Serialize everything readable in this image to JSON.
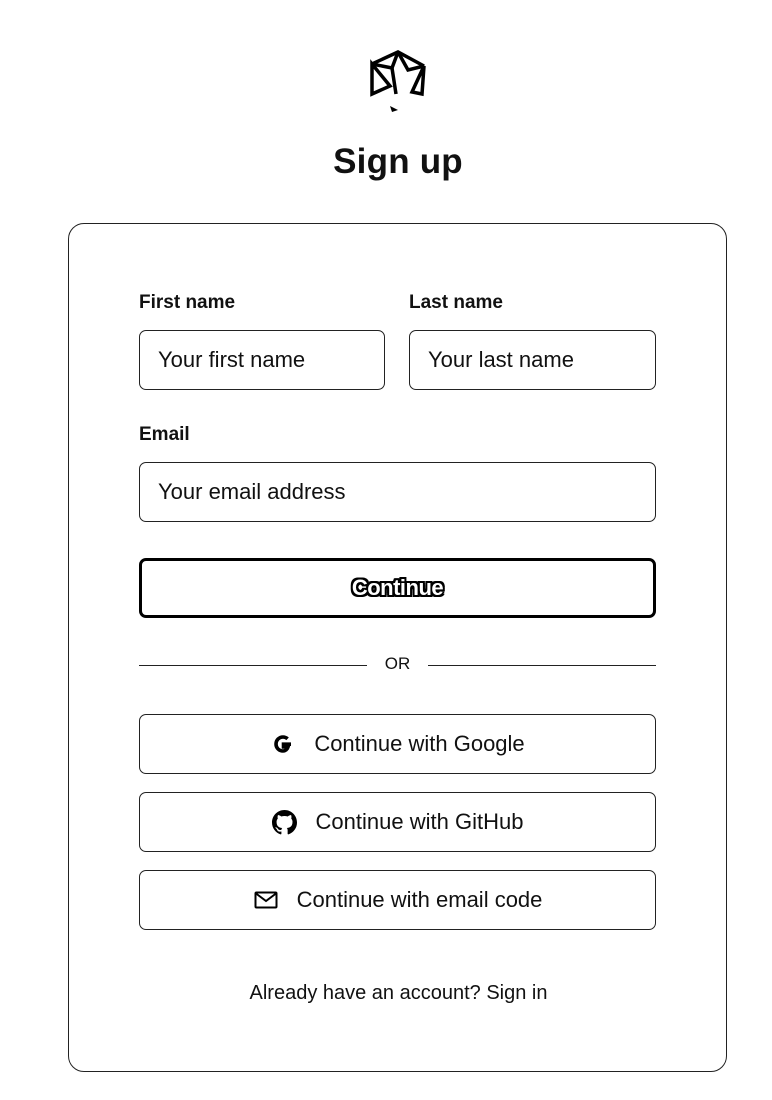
{
  "header": {
    "logo_icon": "prism-logo-icon",
    "title": "Sign up"
  },
  "form": {
    "first_name": {
      "label": "First name",
      "placeholder": "Your first name",
      "value": ""
    },
    "last_name": {
      "label": "Last name",
      "placeholder": "Your last name",
      "value": ""
    },
    "email": {
      "label": "Email",
      "placeholder": "Your email address",
      "value": ""
    },
    "continue_label": "Continue"
  },
  "divider": {
    "text": "OR"
  },
  "social": [
    {
      "icon": "google-icon",
      "label": "Continue with Google"
    },
    {
      "icon": "github-icon",
      "label": "Continue with GitHub"
    },
    {
      "icon": "mail-icon",
      "label": "Continue with email code"
    }
  ],
  "footer": {
    "prompt": "Already have an account?",
    "link": "Sign in"
  },
  "colors": {
    "text": "#111111",
    "border": "#222222",
    "background": "#ffffff"
  }
}
